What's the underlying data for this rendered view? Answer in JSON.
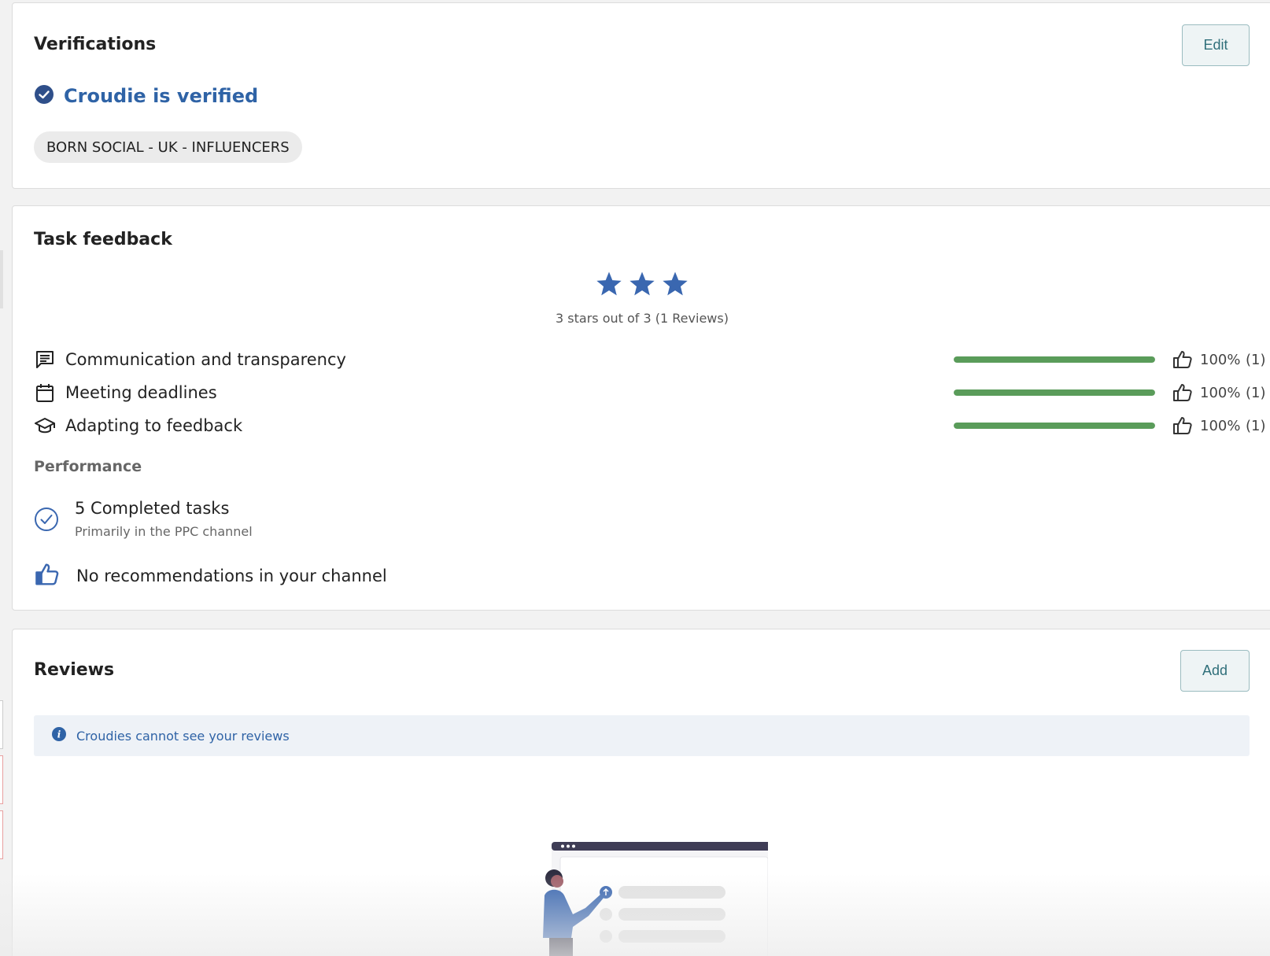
{
  "verifications": {
    "title": "Verifications",
    "edit_label": "Edit",
    "verified_text": "Croudie is verified",
    "tag": "BORN SOCIAL - UK - INFLUENCERS"
  },
  "task_feedback": {
    "title": "Task feedback",
    "stars": 3,
    "max_stars": 3,
    "summary": "3 stars out of 3 (1 Reviews)",
    "items": [
      {
        "icon": "comment-icon",
        "label": "Communication and transparency",
        "percent_value": 100,
        "percent": "100%",
        "count": "(1)"
      },
      {
        "icon": "calendar-icon",
        "label": "Meeting deadlines",
        "percent_value": 100,
        "percent": "100%",
        "count": "(1)"
      },
      {
        "icon": "graduation-cap-icon",
        "label": "Adapting to feedback",
        "percent_value": 100,
        "percent": "100%",
        "count": "(1)"
      }
    ],
    "performance": {
      "title": "Performance",
      "completed": "5 Completed tasks",
      "completed_sub": "Primarily in the PPC channel",
      "recommendations": "No recommendations in your channel"
    }
  },
  "reviews": {
    "title": "Reviews",
    "add_label": "Add",
    "info_text": "Croudies cannot see your reviews"
  },
  "colors": {
    "accent_blue": "#2f63a6",
    "bar_green": "#5a9c5a",
    "button_teal": "#2f6f7a"
  }
}
